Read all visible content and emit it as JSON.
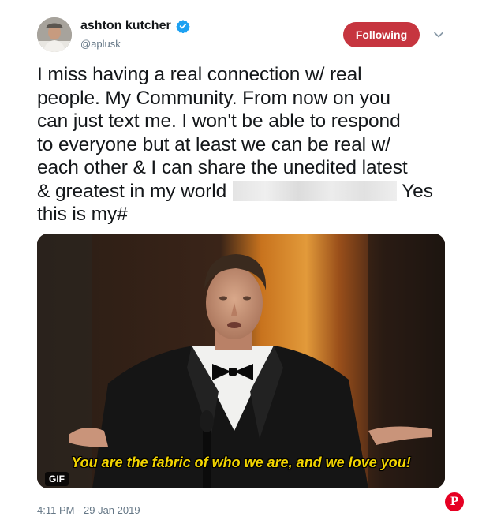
{
  "author": {
    "display_name": "ashton kutcher",
    "handle": "@aplusk",
    "verified_icon": "verified-badge-icon",
    "avatar_icon": "user-avatar"
  },
  "follow_button": {
    "label": "Following",
    "color": "#c6353f"
  },
  "menu_icon": "chevron-down-icon",
  "tweet": {
    "lines": [
      "I miss having a real connection w/ real",
      "people. My Community. From now on you",
      "can just text me. I won't be able to respond",
      "to everyone but at least we can be real w/",
      "each other & I can share the unedited latest"
    ],
    "line6_before": "& greatest in my world",
    "line6_after": "Yes",
    "line7": "this is my#"
  },
  "media": {
    "caption": "You are the fabric of who we are, and we love you!",
    "badge": "GIF",
    "caption_color": "#f2d400"
  },
  "timestamp": "4:11 PM - 29 Jan 2019",
  "pin_button": {
    "label": "P",
    "icon": "pinterest-icon",
    "color": "#e60023"
  }
}
